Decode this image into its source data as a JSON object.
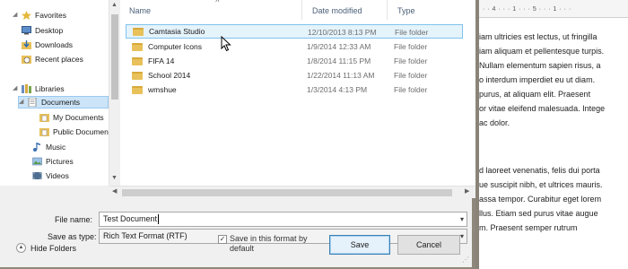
{
  "nav": {
    "items": [
      {
        "label": "Favorites",
        "icon": "star-icon",
        "level": 0,
        "arrow": true
      },
      {
        "label": "Desktop",
        "icon": "desktop-icon",
        "level": 1
      },
      {
        "label": "Downloads",
        "icon": "downloads-icon",
        "level": 1
      },
      {
        "label": "Recent places",
        "icon": "recent-places-icon",
        "level": 1
      },
      {
        "label": "Libraries",
        "icon": "libraries-icon",
        "level": 0,
        "arrow": true
      },
      {
        "label": "Documents",
        "icon": "documents-icon",
        "level": 1,
        "selected": true,
        "arrow": true
      },
      {
        "label": "My Documents",
        "icon": "folder-icon",
        "level": 2
      },
      {
        "label": "Public Documents",
        "icon": "folder-icon",
        "level": 2
      },
      {
        "label": "Music",
        "icon": "music-icon",
        "level": 1
      },
      {
        "label": "Pictures",
        "icon": "pictures-icon",
        "level": 1
      },
      {
        "label": "Videos",
        "icon": "videos-icon",
        "level": 1
      }
    ]
  },
  "file_list": {
    "columns": {
      "name": "Name",
      "date": "Date modified",
      "type": "Type"
    },
    "rows": [
      {
        "name": "Camtasia Studio",
        "date": "12/10/2013 8:13 PM",
        "type": "File folder",
        "hover": true
      },
      {
        "name": "Computer Icons",
        "date": "1/9/2014 12:33 AM",
        "type": "File folder"
      },
      {
        "name": "FIFA 14",
        "date": "1/8/2014 11:15 PM",
        "type": "File folder"
      },
      {
        "name": "School 2014",
        "date": "1/22/2014 11:13 AM",
        "type": "File folder"
      },
      {
        "name": "wmshue",
        "date": "1/3/2014 4:13 PM",
        "type": "File folder"
      }
    ]
  },
  "form": {
    "file_name_label": "File name:",
    "file_name_value": "Test Document",
    "save_as_type_label": "Save as type:",
    "save_as_type_value": "Rich Text Format (RTF)"
  },
  "footer": {
    "hide_folders": "Hide Folders",
    "save_format_line1": "Save in this format by",
    "save_format_line2": "default",
    "save_format_checked": true,
    "save_button": "Save",
    "cancel_button": "Cancel"
  },
  "document": {
    "ruler": "· · 4 · · · 1 · · · 5 · · · 1 · · ·",
    "lines": [
      "iam ultricies est lectus, ut fringilla",
      "iam aliquam et pellentesque turpis.",
      "Nullam elementum sapien risus, a",
      "o interdum imperdiet eu ut diam.",
      "purus, at aliquam elit. Praesent",
      "or vitae eleifend malesuada. Intege",
      "ac dolor.",
      "d laoreet venenatis, felis dui porta",
      "ue suscipit nibh, et ultrices mauris.",
      "assa tempor. Curabitur eget lorem",
      "llus. Etiam sed purus vitae augue",
      "m. Praesent semper rutrum"
    ]
  },
  "colors": {
    "selection": "#cce4f7",
    "hover_row": "#e5f3fb",
    "folder": "#e8c15a",
    "primary_button_border": "#3c7fb1"
  }
}
